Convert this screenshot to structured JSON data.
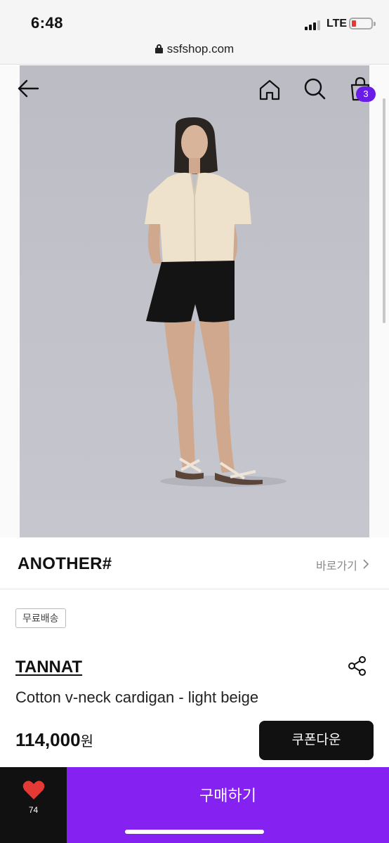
{
  "status_bar": {
    "time": "6:48",
    "network": "LTE"
  },
  "browser": {
    "url": "ssfshop.com"
  },
  "header": {
    "back_icon": "arrow-left-icon",
    "home_icon": "home-icon",
    "search_icon": "search-icon",
    "bag_icon": "shopping-bag-icon",
    "bag_count": "3"
  },
  "gallery": {
    "pager_progress": 0.5
  },
  "brand": {
    "name": "ANOTHER#",
    "link_label": "바로가기"
  },
  "product": {
    "badge": "무료배송",
    "brand": "TANNAT",
    "name": "Cotton v-neck cardigan - light beige",
    "price": "114,000",
    "currency": "원",
    "coupon_label": "쿠폰다운"
  },
  "bottom_bar": {
    "wish_count": "74",
    "buy_label": "구매하기"
  },
  "colors": {
    "accent": "#8522f2",
    "badge": "#6a1be8",
    "wish": "#e53935"
  }
}
